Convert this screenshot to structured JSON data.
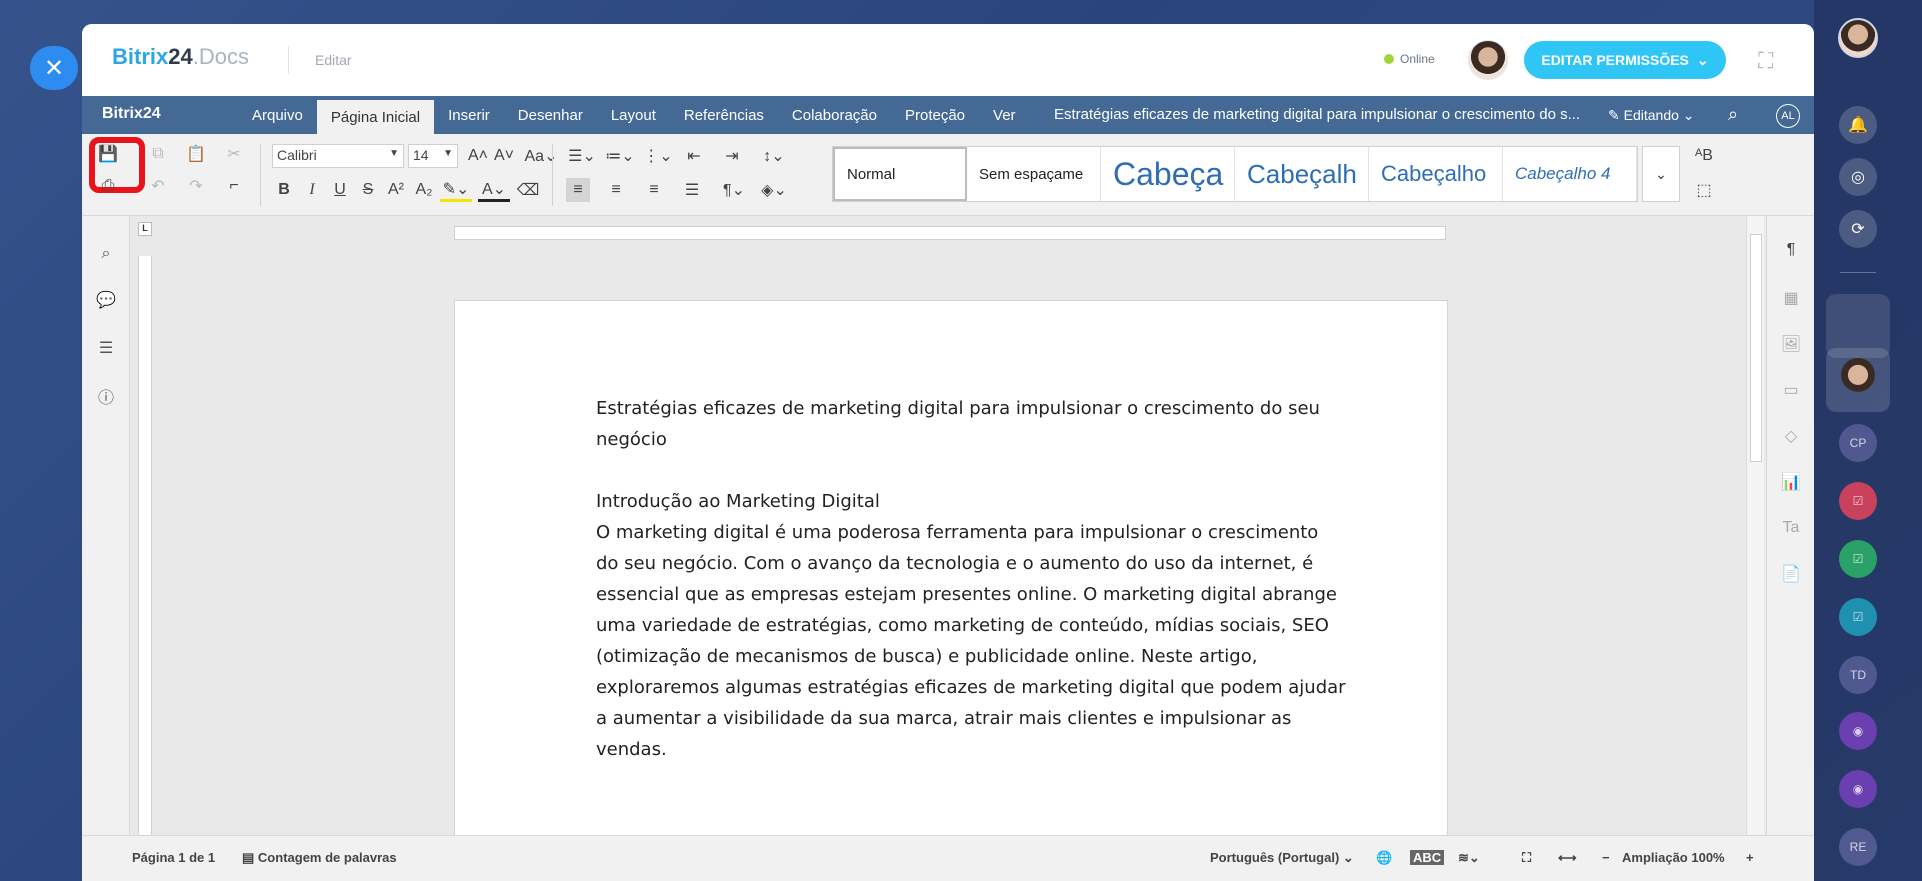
{
  "header": {
    "logo_main": "Bitrix",
    "logo_num": "24",
    "logo_docs": ".Docs",
    "mode_label": "Editar",
    "status": "Online",
    "permissions_button": "EDITAR PERMISSÕES"
  },
  "menubar": {
    "logo": "Bitrix24",
    "tabs": [
      "Arquivo",
      "Página Inicial",
      "Inserir",
      "Desenhar",
      "Layout",
      "Referências",
      "Colaboração",
      "Proteção",
      "Ver"
    ],
    "active_tab": "Página Inicial",
    "doc_title": "Estratégias eficazes de marketing digital para impulsionar o crescimento do s...",
    "editing_label": "Editando",
    "user_initials": "AL"
  },
  "toolbar": {
    "font_name": "Calibri",
    "font_size": "14",
    "styles": [
      "Normal",
      "Sem espaçame",
      "Cabeça",
      "Cabeçalh",
      "Cabeçalho",
      "Cabeçalho 4"
    ]
  },
  "document": {
    "title_line1": "Estratégias eficazes de marketing digital para impulsionar o crescimento do seu",
    "title_line2": "negócio",
    "heading": "Introdução ao Marketing Digital",
    "body_lines": [
      "O marketing digital é uma poderosa ferramenta para impulsionar o crescimento",
      "do seu negócio. Com o avanço da tecnologia e o aumento do uso da internet, é",
      "essencial que as empresas estejam presentes online. O marketing digital abrange",
      "uma variedade de estratégias, como marketing de conteúdo, mídias sociais, SEO",
      "(otimização de mecanismos de busca) e publicidade online. Neste artigo,",
      "exploraremos algumas estratégias eficazes de marketing digital que podem ajudar",
      "a aumentar a visibilidade da sua marca, atrair mais clientes e impulsionar as",
      "vendas."
    ]
  },
  "statusbar": {
    "page_info": "Página 1 de 1",
    "word_count": "Contagem de palavras",
    "language": "Português (Portugal)",
    "zoom": "Ampliação 100%"
  },
  "rail": {
    "initials": [
      "CP",
      "TD",
      "RE"
    ]
  },
  "colors": {
    "menubar": "#446995",
    "accent": "#2fc6f6",
    "highlight": "#e8141b"
  }
}
